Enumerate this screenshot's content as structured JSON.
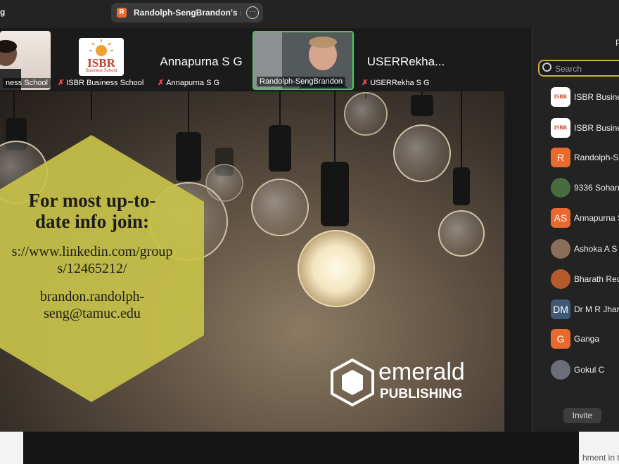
{
  "topbar": {
    "partial_label": "g",
    "share_tab": {
      "icon_letter": "R",
      "title": "Randolph-SengBrandon's scr"
    }
  },
  "gallery": {
    "tiles": [
      {
        "name": "ness School"
      },
      {
        "name": "ISBR Business School",
        "logo_text": "ISBR",
        "logo_sub": "Business School"
      },
      {
        "name": "Annapurna S G",
        "display": "Annapurna S G"
      },
      {
        "name": "Randolph-SengBrandon"
      },
      {
        "name": "USERRekha S G",
        "display": "USERRekha..."
      }
    ]
  },
  "slide": {
    "heading": "For most up-to-date info join:",
    "heading_line1": "For most up-to-",
    "heading_line2": "date info join:",
    "url_line1": "s://www.linkedin.com/group",
    "url_line2": "s/12465212/",
    "email_line1": "brandon.randolph-",
    "email_line2": "seng@tamuc.edu",
    "brand_word": "emerald",
    "brand_sub": "PUBLISHING",
    "hex_color": "#c8c24a"
  },
  "panel": {
    "search_placeholder": "Search",
    "participants": [
      {
        "name": "ISBR Busine",
        "avatar": "logo"
      },
      {
        "name": "ISBR Busine",
        "avatar": "logo"
      },
      {
        "name": "Randolph-Se",
        "avatar": "R",
        "color": "#e96a2c"
      },
      {
        "name": "9336 Sohan",
        "avatar": "photo",
        "color": "#4a6b3e"
      },
      {
        "name": "Annapurna S",
        "avatar": "AS",
        "color": "#e96a2c"
      },
      {
        "name": "Ashoka A S",
        "avatar": "photo",
        "color": "#8b6e5a"
      },
      {
        "name": "Bharath Red",
        "avatar": "photo",
        "color": "#b65a2e"
      },
      {
        "name": "Dr M R Jhar",
        "avatar": "DM",
        "color": "#3e5a78"
      },
      {
        "name": "Ganga",
        "avatar": "G",
        "color": "#e96a2c"
      },
      {
        "name": "Gokul C",
        "avatar": "photo",
        "color": "#6b6e78"
      }
    ],
    "invite_label": "Invite"
  },
  "bottom": {
    "partial_text": "hment in t"
  }
}
